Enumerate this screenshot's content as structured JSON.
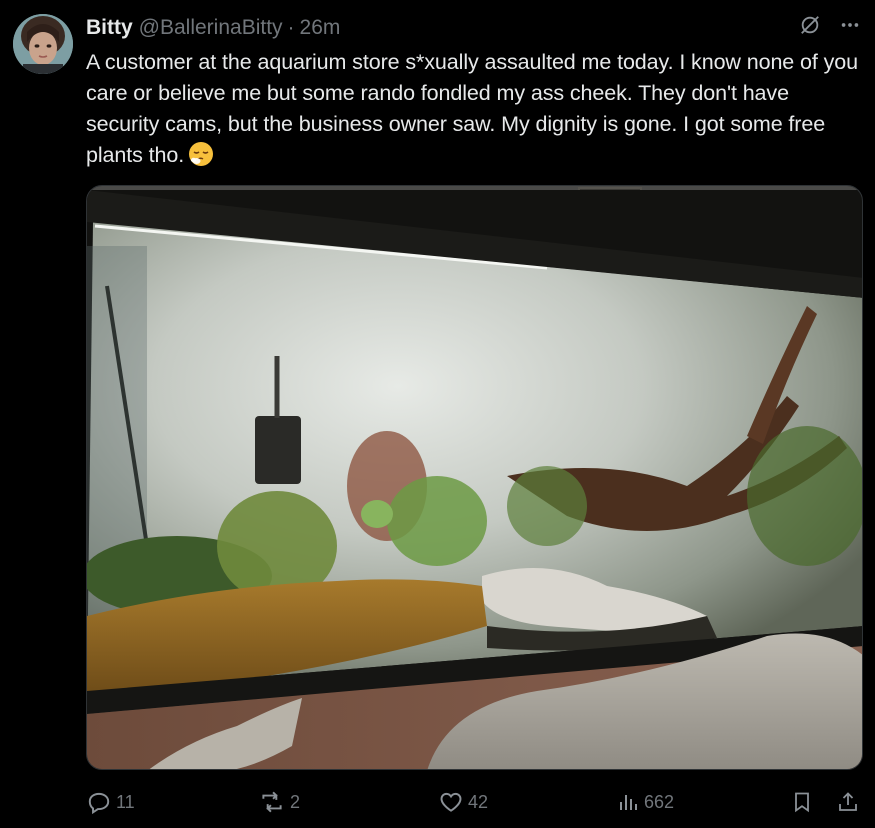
{
  "author": {
    "display_name": "Bitty",
    "handle": "@BallerinaBitty",
    "separator": "·",
    "time_ago": "26m"
  },
  "tweet": {
    "text": "A customer at the aquarium store s*xually assaulted me today. I know none of you care or believe me but some rando fondled my ass cheek. They don't have security cams, but the business owner saw. My dignity is gone. I got some free plants tho.",
    "emoji": "face-exhaling-emoji"
  },
  "media": {
    "description_icon": "aquarium-photo"
  },
  "metrics": {
    "replies": "11",
    "reposts": "2",
    "likes": "42",
    "views": "662"
  },
  "colors": {
    "background": "#000000",
    "text_primary": "#e7e9ea",
    "text_secondary": "#71767b",
    "border": "#2f3336"
  },
  "icons": {
    "grok": "grok-slash-icon",
    "more": "more-icon",
    "reply": "reply-icon",
    "repost": "repost-icon",
    "like": "like-icon",
    "views": "views-icon",
    "bookmark": "bookmark-icon",
    "share": "share-icon"
  }
}
